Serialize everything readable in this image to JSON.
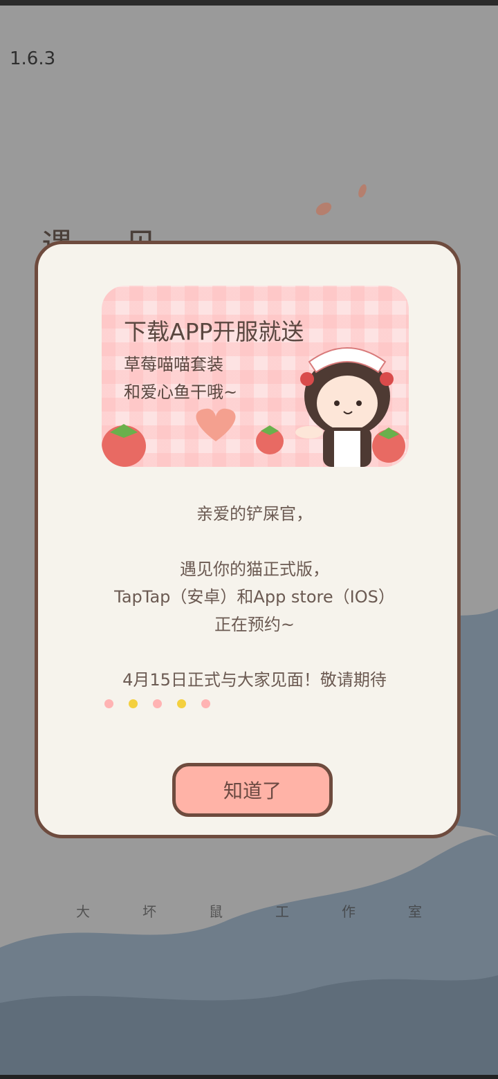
{
  "version": "1.6.3",
  "background": {
    "title_fragment": "遇 见",
    "studio_chars": [
      "大",
      "坏",
      "鼠",
      "工",
      "作",
      "室"
    ]
  },
  "dialog": {
    "banner": {
      "title": "下载APP开服就送",
      "line1": "草莓喵喵套装",
      "line2": "和爱心鱼干哦~"
    },
    "message": {
      "greeting": "亲爱的铲屎官，",
      "line1": "遇见你的猫正式版，",
      "line2": "TapTap（安卓）和App store（IOS）",
      "line3": "正在预约~",
      "line4": "4月15日正式与大家见面！敬请期待"
    },
    "dots_colors": [
      "#ffb3b3",
      "#f4d03f",
      "#ffb3b3",
      "#f4d03f",
      "#ffb3b3"
    ],
    "ok_button": "知道了"
  },
  "colors": {
    "border": "#6e4b3e",
    "button_fill": "#ffb3a7",
    "dialog_bg": "#f6f3ec"
  }
}
